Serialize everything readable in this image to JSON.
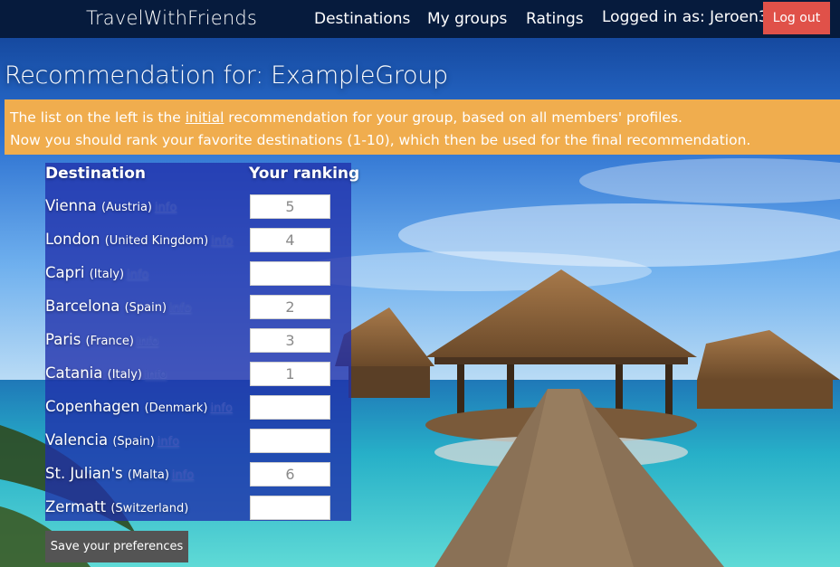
{
  "navbar": {
    "brand": "TravelWithFriends",
    "items": [
      "Destinations",
      "My groups",
      "Ratings"
    ],
    "logged_in": "Logged in as: Jeroen3",
    "logout_label": "Log out"
  },
  "page": {
    "title": "Recommendation for: ExampleGroup"
  },
  "banner": {
    "line1_before": "The list on the left is the ",
    "line1_emphasis": "initial",
    "line1_after": " recommendation for your group, based on all members' profiles.",
    "line2": "Now you should rank your favorite destinations (1-10), which then be used for the final recommendation."
  },
  "table": {
    "headers": {
      "destination": "Destination",
      "ranking": "Your ranking"
    },
    "info_label": "info",
    "rows": [
      {
        "city": "Vienna",
        "country": "(Austria)",
        "ranking": "5"
      },
      {
        "city": "London",
        "country": "(United Kingdom)",
        "ranking": "4"
      },
      {
        "city": "Capri",
        "country": "(Italy)",
        "ranking": ""
      },
      {
        "city": "Barcelona",
        "country": "(Spain)",
        "ranking": "2"
      },
      {
        "city": "Paris",
        "country": "(France)",
        "ranking": "3"
      },
      {
        "city": "Catania",
        "country": "(Italy)",
        "ranking": "1"
      },
      {
        "city": "Copenhagen",
        "country": "(Denmark)",
        "ranking": ""
      },
      {
        "city": "Valencia",
        "country": "(Spain)",
        "ranking": ""
      },
      {
        "city": "St. Julian's",
        "country": "(Malta)",
        "ranking": "6"
      },
      {
        "city": "Zermatt",
        "country": "(Switzerland)",
        "ranking": ""
      }
    ]
  },
  "save_label": "Save your preferences",
  "colors": {
    "navbar": "#061b3d",
    "logout": "#e05149",
    "banner": "#f0ad4e",
    "panel": "#2030aa",
    "save_button": "#545454"
  }
}
